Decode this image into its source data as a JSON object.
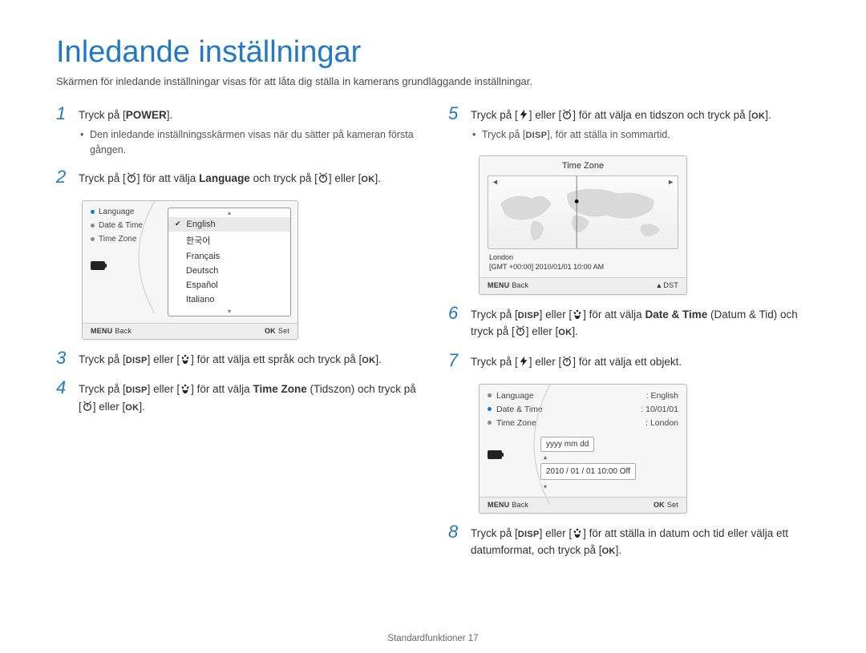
{
  "title": "Inledande inställningar",
  "subtitle": "Skärmen för inledande inställningar visas för att låta dig ställa in kamerans grundläggande inställningar.",
  "page_footer": "Standardfunktioner  17",
  "icons": {
    "power_label": "POWER",
    "ok_label": "OK",
    "disp_label": "DISP",
    "menu_label": "MENU"
  },
  "steps": {
    "s1": {
      "num": "1",
      "text_a": "Tryck på [",
      "text_b": "].",
      "bullet": "Den inledande inställningsskärmen visas när du sätter på kameran första gången."
    },
    "s2": {
      "num": "2",
      "text_a": "Tryck på [",
      "text_b": "] för att välja ",
      "lang": "Language",
      "text_c": " och tryck på [",
      "text_d": "] eller [",
      "text_e": "]."
    },
    "s3": {
      "num": "3",
      "text_a": "Tryck på [",
      "text_b": "] eller [",
      "text_c": "] för att välja ett språk och tryck på [",
      "text_d": "]."
    },
    "s4": {
      "num": "4",
      "text_a": "Tryck på [",
      "text_b": "] eller [",
      "tz": "Time Zone",
      "text_c": "] för att välja ",
      "text_d": " (Tidszon) och tryck på [",
      "text_e": "] eller [",
      "text_f": "]."
    },
    "s5": {
      "num": "5",
      "text_a": "Tryck på [",
      "text_b": "] eller [",
      "text_c": "] för att välja en tidszon och tryck på [",
      "text_d": "].",
      "bullet_a": "Tryck på [",
      "bullet_b": "], för att ställa in sommartid."
    },
    "s6": {
      "num": "6",
      "text_a": "Tryck på [",
      "text_b": "] eller [",
      "dt": "Date & Time",
      "text_c": "] för att välja ",
      "text_d": " (Datum & Tid) och tryck på [",
      "text_e": "] eller [",
      "text_f": "]."
    },
    "s7": {
      "num": "7",
      "text_a": "Tryck på [",
      "text_b": "] eller [",
      "text_c": "] för att välja ett objekt."
    },
    "s8": {
      "num": "8",
      "text_a": "Tryck på [",
      "text_b": "] eller [",
      "text_c": "] för att ställa in datum och tid eller välja ett datumformat, och tryck på [",
      "text_d": "]."
    }
  },
  "screen_lang": {
    "left": {
      "items": [
        "Language",
        "Date & Time",
        "Time Zone"
      ]
    },
    "options": [
      "English",
      "한국어",
      "Français",
      "Deutsch",
      "Español",
      "Italiano"
    ],
    "footer_left": "Back",
    "footer_right": "Set"
  },
  "screen_tz": {
    "title": "Time Zone",
    "city": "London",
    "info": "[GMT +00:00] 2010/01/01 10:00 AM",
    "footer_left": "Back",
    "footer_right_label": "DST"
  },
  "screen_dt": {
    "rows": [
      {
        "label": "Language",
        "value": ": English"
      },
      {
        "label": "Date & Time",
        "value": ": 10/01/01"
      },
      {
        "label": "Time Zone",
        "value": ": London"
      }
    ],
    "format_label": "yyyy  mm   dd",
    "value_line": "2010 / 01 / 01  10:00    Off",
    "footer_left": "Back",
    "footer_right": "Set"
  }
}
